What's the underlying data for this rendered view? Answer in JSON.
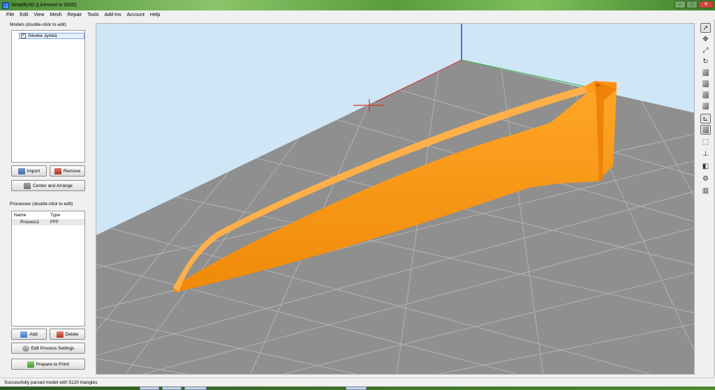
{
  "window": {
    "title": "Simplify3D (Licensed to GOD)"
  },
  "menu": [
    "File",
    "Edit",
    "View",
    "Mesh",
    "Repair",
    "Tools",
    "Add-Ins",
    "Account",
    "Help"
  ],
  "models": {
    "label": "Models (double-click to edit)",
    "items": [
      {
        "name": "Siiveke Jyrkkä",
        "checked": true
      }
    ],
    "import_label": "Import",
    "remove_label": "Remove",
    "center_label": "Center and Arrange"
  },
  "processes": {
    "label": "Processes (double-click to edit)",
    "columns": [
      "Name",
      "Type"
    ],
    "rows": [
      {
        "name": "Process1",
        "type": "FFF"
      }
    ],
    "add_label": "Add",
    "delete_label": "Delete",
    "edit_label": "Edit Process Settings",
    "prepare_label": "Prepare to Print!"
  },
  "status": {
    "message": "Successfully parsed model with 5120 triangles"
  },
  "toolbar": {
    "icons": [
      "select-icon",
      "move-icon",
      "scale-icon",
      "rotate-icon",
      "view-front-icon",
      "view-top-icon",
      "view-left-icon",
      "view-right-icon",
      "axes-icon",
      "shaded-cube-icon",
      "wireframe-cube-icon",
      "normals-icon",
      "cross-section-icon",
      "gear-icon",
      "layers-icon"
    ]
  },
  "colors": {
    "model": "#ff9a1a",
    "bed_grid": "#8f8f8f",
    "sky": "#cfe6f6"
  }
}
